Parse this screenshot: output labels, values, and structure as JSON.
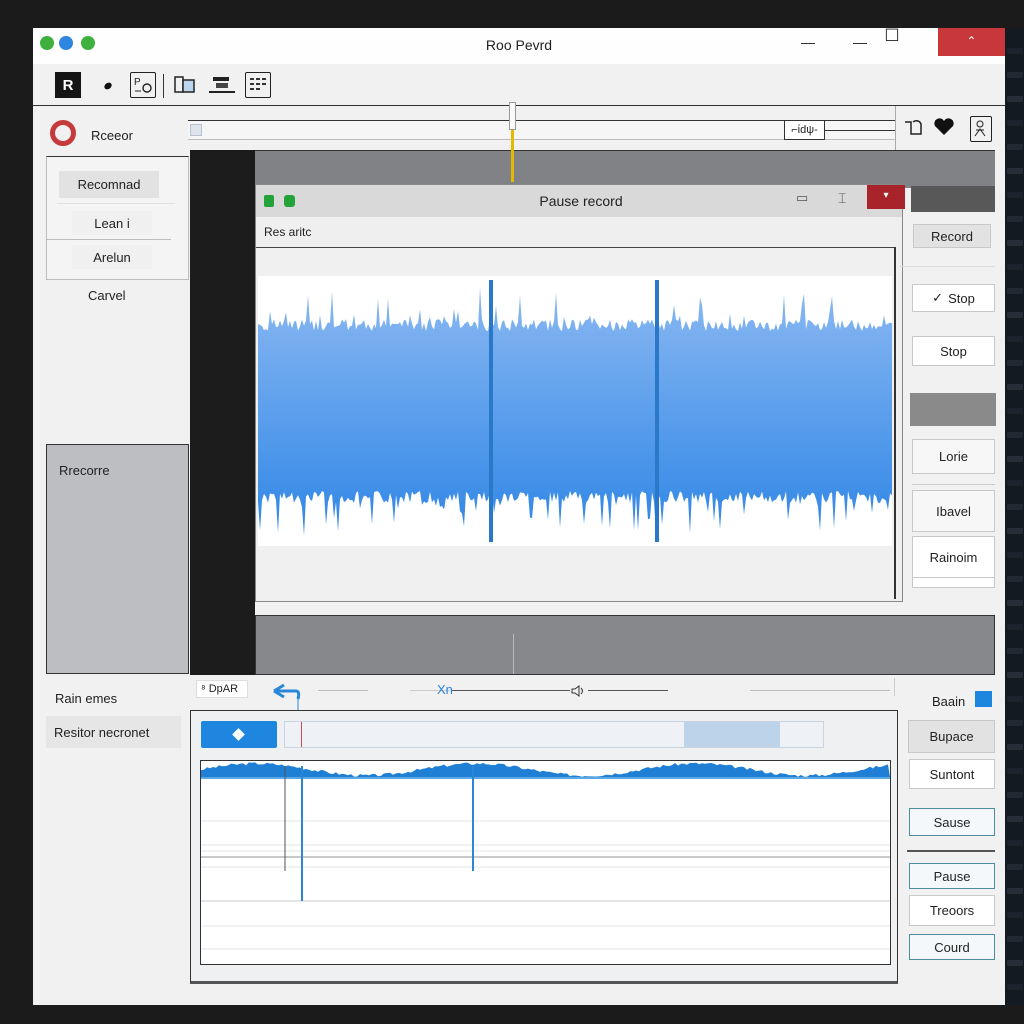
{
  "window": {
    "title": "Roo Pevrd",
    "traffic_lights": [
      "#3db03d",
      "#2f86e0",
      "#3db03d"
    ],
    "controls": {
      "minimize": "—",
      "minimize2": "—",
      "maximize": "☐",
      "close": "⌃"
    }
  },
  "toolbar": {
    "icons": [
      "app-logo-icon",
      "brush-icon",
      "camera-icon",
      "devices-icon",
      "mixer-icon",
      "grid-icon"
    ],
    "logo_label": "R"
  },
  "header": {
    "record_label": "Rceeor",
    "timeline_readout": "⌐ἰdψ-ϑ=ⓟ",
    "right_icons": [
      "loop-icon",
      "heart-icon",
      "user-card-icon"
    ]
  },
  "left_panel": {
    "items": [
      {
        "label": "Recomnad",
        "selected": true
      },
      {
        "label": "Lean i",
        "selected": false
      },
      {
        "label": "Arelun",
        "selected": false
      }
    ],
    "cancel_label": "Carvel",
    "preview_label": "Rrecorre",
    "bottom_items": [
      "Rain emes",
      "Resitor necronet"
    ]
  },
  "dialog": {
    "title": "Pause record",
    "subtitle": "Res aritc",
    "controls": {
      "restore": "▭",
      "pin": "⌶",
      "close": "▾"
    }
  },
  "right_buttons_top": [
    {
      "label": "Record",
      "style": "gray"
    },
    {
      "label": "Stop",
      "icon": "check-icon",
      "style": "white"
    },
    {
      "label": "Stop",
      "style": "white"
    },
    {
      "label": "",
      "style": "dark"
    },
    {
      "label": "Lorie",
      "style": "white"
    },
    {
      "label": "Ibavel",
      "style": "white"
    },
    {
      "label": "Rainoim",
      "style": "white"
    }
  ],
  "transport": {
    "field_label": "⁸ DpAR",
    "marker_label": "Xn",
    "volume_icon": "speaker-icon"
  },
  "bottom_right": {
    "swatch_label": "Baain",
    "swatch_color": "#1f86e0",
    "buttons": [
      {
        "label": "Bupace",
        "style": "gray"
      },
      {
        "label": "Suntont",
        "style": "white"
      },
      {
        "label": "Sause",
        "style": "teal"
      },
      {
        "label": "Pause",
        "style": "teal"
      },
      {
        "label": "Treoors",
        "style": "white"
      },
      {
        "label": "Courd",
        "style": "teal"
      }
    ]
  },
  "progress": {
    "fill_fraction": 0.79
  },
  "colors": {
    "accent": "#1f86e0",
    "waveform_top": "#8ab8f2",
    "waveform_bottom": "#2f86e6",
    "playhead": "#e5b900",
    "close_red": "#c8383a"
  }
}
